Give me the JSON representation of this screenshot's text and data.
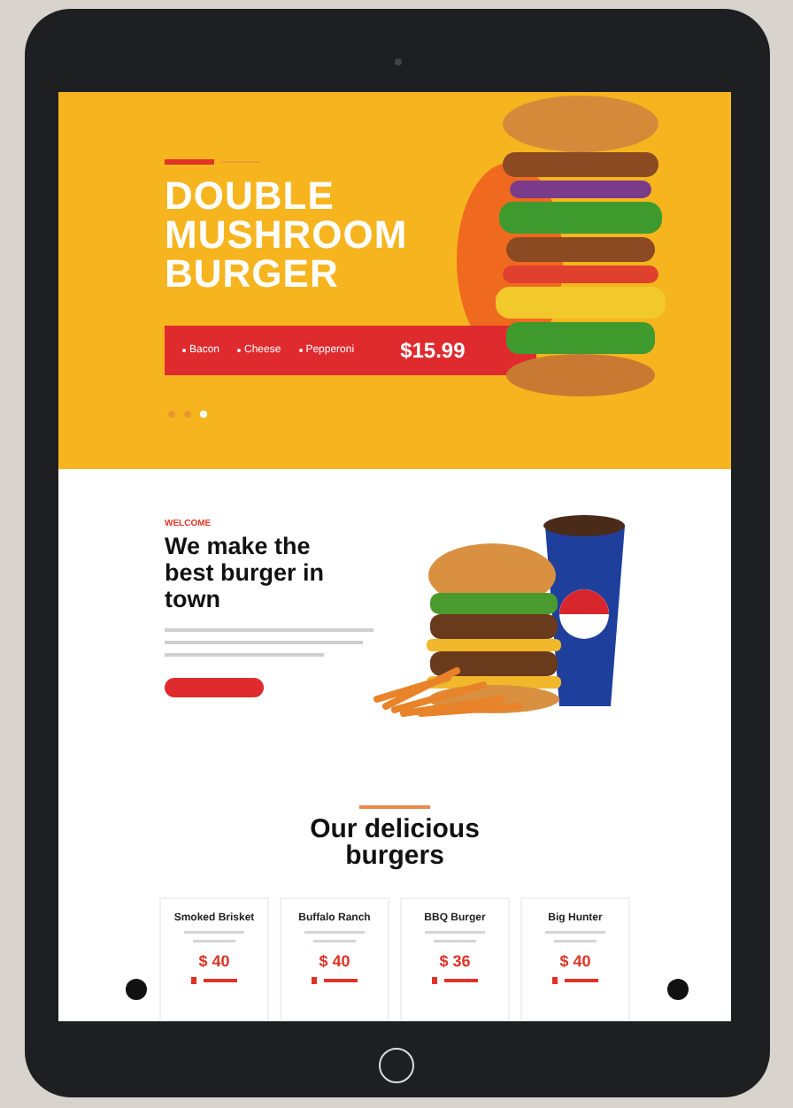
{
  "hero": {
    "title": [
      "DOUBLE",
      "MUSHROOM",
      "BURGER"
    ],
    "toppings": [
      "Bacon",
      "Cheese",
      "Pepperoni"
    ],
    "price": "$15.99",
    "slides": [
      {
        "selected": false
      },
      {
        "selected": false
      },
      {
        "selected": true
      }
    ]
  },
  "welcome": {
    "eyebrow": "WELCOME",
    "heading": "We make the best burger in town"
  },
  "combos": {
    "heading": "Our delicious burgers",
    "cards": [
      {
        "name": "Smoked Brisket",
        "price": "$ 40"
      },
      {
        "name": "Buffalo Ranch",
        "price": "$ 40"
      },
      {
        "name": "BBQ Burger",
        "price": "$ 36"
      },
      {
        "name": "Big Hunter",
        "price": "$ 40"
      }
    ]
  }
}
